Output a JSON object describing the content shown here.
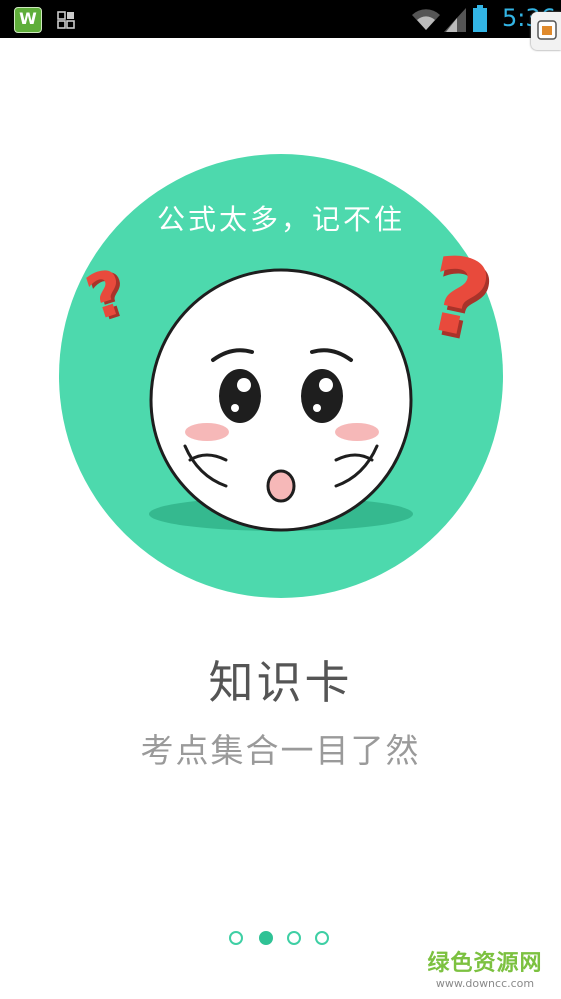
{
  "status_bar": {
    "time": "5:36",
    "app_icon_letter": "W",
    "colors": {
      "background": "#000000",
      "icon_accent": "#33b5e5"
    },
    "icons": [
      "app-icon",
      "grid-icon",
      "wifi-icon",
      "signal-icon",
      "battery-icon"
    ]
  },
  "illustration": {
    "caption": "公式太多，记不住",
    "colors": {
      "circle": "#4dd9ad",
      "question_mark": "#e84a3c",
      "face": "#ffffff",
      "blush": "#f6b8b8"
    }
  },
  "page": {
    "title": "知识卡",
    "subtitle": "考点集合一目了然"
  },
  "pager": {
    "total": 4,
    "active_index": 1,
    "color": "#2fc295"
  },
  "watermark": {
    "text": "绿色资源网",
    "url": "www.downcc.com"
  }
}
